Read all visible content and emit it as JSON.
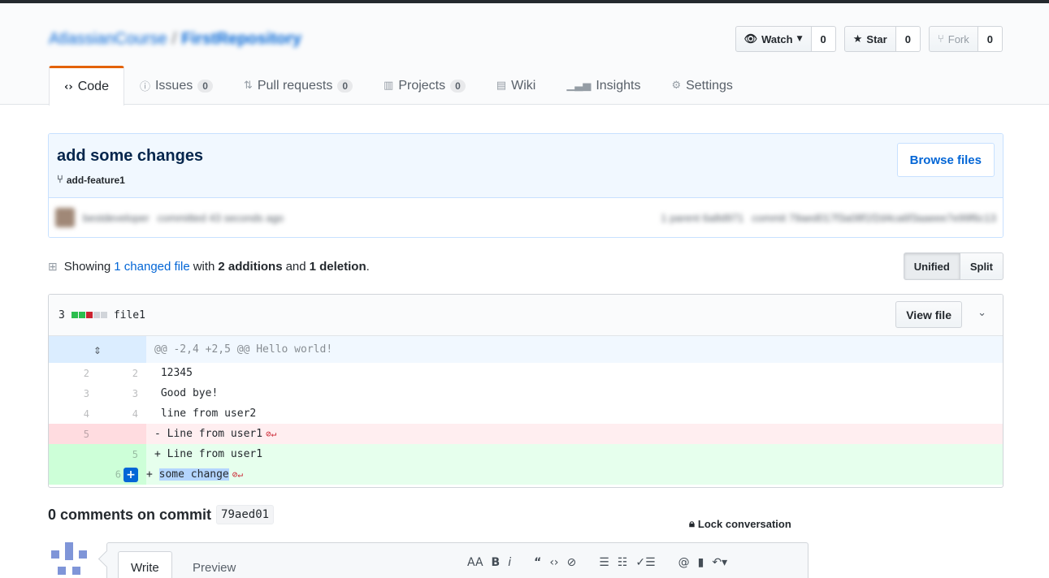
{
  "repo": {
    "owner": "AtlassianCourse",
    "name": "FirstRepository",
    "watch_label": "Watch",
    "watch_count": "0",
    "star_label": "Star",
    "star_count": "0",
    "fork_label": "Fork",
    "fork_count": "0"
  },
  "tabs": [
    {
      "label": "Code",
      "icon": "code-icon"
    },
    {
      "label": "Issues",
      "count": "0",
      "icon": "issue-icon"
    },
    {
      "label": "Pull requests",
      "count": "0",
      "icon": "pull-request-icon"
    },
    {
      "label": "Projects",
      "count": "0",
      "icon": "project-icon"
    },
    {
      "label": "Wiki",
      "icon": "wiki-icon"
    },
    {
      "label": "Insights",
      "icon": "graph-icon"
    },
    {
      "label": "Settings",
      "icon": "gear-icon"
    }
  ],
  "commit": {
    "title": "add some changes",
    "branch": "add-feature1",
    "browse_label": "Browse files",
    "author": "bestdeveloper",
    "authored": "committed 43 seconds ago",
    "parent": "1 parent  6a8d971",
    "commit_ref": "commit  79aed017f3a08f1f2d4ca6f3aaeee7e99f6c13"
  },
  "toc": {
    "showing": "Showing",
    "changed": "1 changed file",
    "with": "with",
    "additions": "2 additions",
    "and": "and",
    "deletions": "1 deletion",
    "period": ".",
    "unified": "Unified",
    "split": "Split"
  },
  "file": {
    "changes": "3",
    "name": "file1",
    "view_label": "View file",
    "diffstat": [
      "#2cbe4e",
      "#2cbe4e",
      "#cb2431",
      "#d1d5da",
      "#d1d5da"
    ],
    "hunk": "@@ -2,4 +2,5 @@ Hello world!",
    "lines": [
      {
        "old": "2",
        "new": "2",
        "text": " 12345"
      },
      {
        "old": "3",
        "new": "3",
        "text": " Good bye!"
      },
      {
        "old": "4",
        "new": "4",
        "text": " line from user2"
      },
      {
        "old": "5",
        "new": "",
        "text": "- Line from user1"
      },
      {
        "old": "",
        "new": "5",
        "text": "+ Line from user1"
      },
      {
        "old": "",
        "new": "6",
        "sign": "+",
        "text": "some change"
      }
    ]
  },
  "comments": {
    "title": "0 comments on commit",
    "sha": "79aed01",
    "lock": "Lock conversation",
    "write": "Write",
    "preview": "Preview"
  },
  "colors": {
    "accent": "#0366d6",
    "tab_highlight": "#e36209",
    "addition": "#e6ffed",
    "deletion": "#ffeef0"
  }
}
